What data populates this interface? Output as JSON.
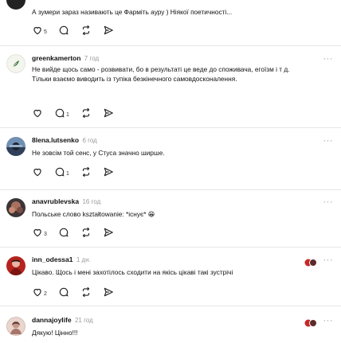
{
  "posts": [
    {
      "username": "",
      "time": "",
      "text": "А зумери зараз називають це Фарміть ауру ) Ніякої поетичності...",
      "likes": "5",
      "replies": ""
    },
    {
      "username": "greenkamerton",
      "time": "7 год",
      "text": "Не вийде щось само - розвивати, бо в результаті це веде до споживача, егоїзм і т д. Тільки взаємо виводить із тупіка безкінечного самовдосконалення.",
      "likes": "",
      "replies": "1"
    },
    {
      "username": "8lena.lutsenko",
      "time": "6 год",
      "text": "Не зовсім той сенс, у Стуса значно ширше.",
      "likes": "",
      "replies": "1"
    },
    {
      "username": "anavrublevska",
      "time": "16 год",
      "text": "Польське слово kształtowanie: *існує*",
      "emoji": "😁",
      "likes": "3",
      "replies": ""
    },
    {
      "username": "inn_odessa1",
      "time": "1 дн.",
      "text": "Цікаво. Щось і мені захотілось сходити на якісь цікаві такі зустрічі",
      "likes": "2",
      "replies": ""
    },
    {
      "username": "dannajoylife",
      "time": "21 год",
      "text": "Дякую! Цінно!!!",
      "likes": "",
      "replies": ""
    }
  ],
  "more_glyph": "···",
  "icons": [
    "heart-icon",
    "comment-icon",
    "repost-icon",
    "share-icon",
    "more-icon"
  ],
  "colors": {
    "text": "#111111",
    "muted": "#9a9a9a",
    "divider": "#e6e6e6"
  }
}
